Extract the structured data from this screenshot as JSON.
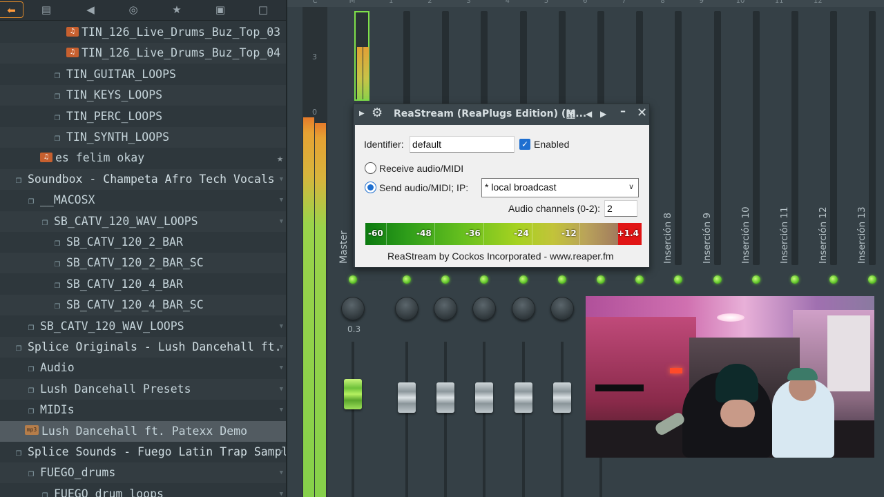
{
  "browser": {
    "toolbar": {
      "back_icon": "back-arrow-icon",
      "icons": [
        "files-icon",
        "speaker-icon",
        "globe-icon",
        "star-icon",
        "pack-icon",
        "folder-add-icon"
      ],
      "glyphs": [
        "▤",
        "◀",
        "◎",
        "★",
        "▣",
        "□"
      ]
    },
    "rows": [
      {
        "label": "TIN_126_Live_Drums_Buz_Top_03",
        "kind": "audio",
        "indent": 96
      },
      {
        "label": "TIN_126_Live_Drums_Buz_Top_04",
        "kind": "audio",
        "indent": 96
      },
      {
        "label": "TIN_GUITAR_LOOPS",
        "kind": "folder",
        "indent": 74
      },
      {
        "label": "TIN_KEYS_LOOPS",
        "kind": "folder",
        "indent": 74
      },
      {
        "label": "TIN_PERC_LOOPS",
        "kind": "folder",
        "indent": 74
      },
      {
        "label": "TIN_SYNTH_LOOPS",
        "kind": "folder",
        "indent": 74
      },
      {
        "label": "es felim okay",
        "kind": "audio",
        "indent": 58,
        "starred": true
      },
      {
        "label": "Soundbox - Champeta Afro Tech Vocals",
        "kind": "pack",
        "indent": 18
      },
      {
        "label": "__MACOSX",
        "kind": "folder",
        "indent": 36
      },
      {
        "label": "SB_CATV_120_WAV_LOOPS",
        "kind": "folder",
        "indent": 56
      },
      {
        "label": "SB_CATV_120_2_BAR",
        "kind": "folder",
        "indent": 74
      },
      {
        "label": "SB_CATV_120_2_BAR_SC",
        "kind": "folder",
        "indent": 74
      },
      {
        "label": "SB_CATV_120_4_BAR",
        "kind": "folder",
        "indent": 74
      },
      {
        "label": "SB_CATV_120_4_BAR_SC",
        "kind": "folder",
        "indent": 74
      },
      {
        "label": "SB_CATV_120_WAV_LOOPS",
        "kind": "folder",
        "indent": 36
      },
      {
        "label": "Splice Originals - Lush Dancehall ft. Patexx",
        "kind": "pack",
        "indent": 18
      },
      {
        "label": "Audio",
        "kind": "folder",
        "indent": 36
      },
      {
        "label": "Lush Dancehall Presets",
        "kind": "folder",
        "indent": 36
      },
      {
        "label": "MIDIs",
        "kind": "folder",
        "indent": 36
      },
      {
        "label": "Lush Dancehall ft. Patexx Demo",
        "kind": "mp3",
        "indent": 36,
        "selected": true
      },
      {
        "label": "Splice Sounds - Fuego Latin Trap Sample Pack",
        "kind": "pack",
        "indent": 18
      },
      {
        "label": "FUEGO_drums",
        "kind": "folder",
        "indent": 36
      },
      {
        "label": "FUEGO_drum_loops",
        "kind": "folder",
        "indent": 56
      }
    ],
    "icons": {
      "folder": "folder-icon",
      "audio": "audio-file-icon",
      "mp3": "mp3-file-icon",
      "pack": "folder-icon",
      "star": "star-icon",
      "arrow": "collapse-arrow-icon"
    },
    "mp3_badge": "mp3"
  },
  "mixer": {
    "header_labels": [
      "C",
      "M",
      "1",
      "2",
      "3",
      "4",
      "5",
      "6",
      "7",
      "8",
      "9",
      "10",
      "11",
      "12"
    ],
    "master_label": "Master",
    "insert_labels": [
      "Inserción 8",
      "Inserción 9",
      "Inserción 10",
      "Inserción 11",
      "Inserción 12",
      "Inserción 13"
    ],
    "scale_3": "3",
    "scale_0": "0",
    "master_pan_value": "0.3",
    "accent_green": "#7fe04a",
    "meter_orange": "#e57a2a"
  },
  "plugin": {
    "title": "ReaStream (ReaPlugs Edition) (M...",
    "icons": {
      "expand": "triangle-right-icon",
      "gear": "gear-icon",
      "grid": "grid-icon",
      "prev": "prev-arrow-icon",
      "next": "next-arrow-icon",
      "minimize": "minimize-icon",
      "close": "close-icon"
    },
    "identifier_label": "Identifier:",
    "identifier_value": "default",
    "enabled_label": "Enabled",
    "enabled": true,
    "receive_label": "Receive audio/MIDI",
    "send_label": "Send audio/MIDI; IP:",
    "mode": "send",
    "ip_value": "* local broadcast",
    "channels_label": "Audio channels (0-2):",
    "channels_value": "2",
    "vu_labels": [
      "-60",
      "-48",
      "-36",
      "-24",
      "-12"
    ],
    "vu_peak": "+1.4",
    "footer": "ReaStream by Cockos Incorporated - www.reaper.fm",
    "accent": "#1e6fd0",
    "peak_color": "#e11515"
  }
}
